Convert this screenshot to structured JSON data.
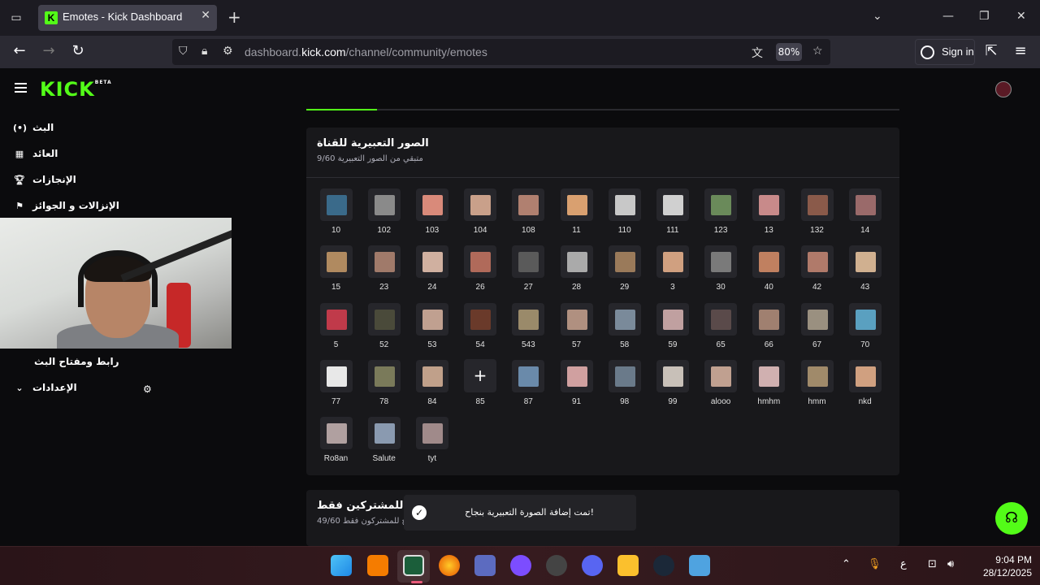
{
  "browser": {
    "tab_title": "Emotes - Kick Dashboard",
    "url_prefix": "dashboard.",
    "url_domain": "kick.com",
    "url_path": "/channel/community/emotes",
    "zoom": "80%",
    "sign_in": "Sign in"
  },
  "app": {
    "logo": "KICK",
    "logo_badge": "BETA"
  },
  "sidebar": {
    "items": [
      {
        "label": "البث",
        "icon": "broadcast-icon"
      },
      {
        "label": "العائد",
        "icon": "revenue-icon"
      },
      {
        "label": "الإنجازات",
        "icon": "trophy-icon"
      },
      {
        "label": "الإنزالات و الجوائز",
        "icon": "drops-icon"
      }
    ],
    "stream_key": "رابط ومفتاح البث",
    "settings": "الإعدادات"
  },
  "channel_emotes": {
    "title": "الصور التعبيرية للقناة",
    "subtitle": "متبقي من الصور التعبيرية 9/60",
    "emotes": [
      {
        "name": "10",
        "color": "#3a6a8a"
      },
      {
        "name": "102",
        "color": "#8a8a8a"
      },
      {
        "name": "103",
        "color": "#d98a7a"
      },
      {
        "name": "104",
        "color": "#c9a08a"
      },
      {
        "name": "108",
        "color": "#b08070"
      },
      {
        "name": "11",
        "color": "#d9a070"
      },
      {
        "name": "110",
        "color": "#c8c8c8"
      },
      {
        "name": "111",
        "color": "#d0d0d0"
      },
      {
        "name": "123",
        "color": "#6a8a5a"
      },
      {
        "name": "13",
        "color": "#c88a8a"
      },
      {
        "name": "132",
        "color": "#8a5a4a"
      },
      {
        "name": "14",
        "color": "#9a6a6a"
      },
      {
        "name": "15",
        "color": "#b08a60"
      },
      {
        "name": "23",
        "color": "#a07a6a"
      },
      {
        "name": "24",
        "color": "#d0b0a0"
      },
      {
        "name": "26",
        "color": "#b06a5a"
      },
      {
        "name": "27",
        "color": "#5a5a5a"
      },
      {
        "name": "28",
        "color": "#aaaaaa"
      },
      {
        "name": "29",
        "color": "#9a7a5a"
      },
      {
        "name": "3",
        "color": "#d0a080"
      },
      {
        "name": "30",
        "color": "#7a7a7a"
      },
      {
        "name": "40",
        "color": "#c08060"
      },
      {
        "name": "42",
        "color": "#b07a6a"
      },
      {
        "name": "43",
        "color": "#d0b090"
      },
      {
        "name": "5",
        "color": "#c03a4a"
      },
      {
        "name": "52",
        "color": "#4a4a3a"
      },
      {
        "name": "53",
        "color": "#c0a090"
      },
      {
        "name": "54",
        "color": "#6a3a2a"
      },
      {
        "name": "543",
        "color": "#9a8a6a"
      },
      {
        "name": "57",
        "color": "#b09080"
      },
      {
        "name": "58",
        "color": "#7a8a9a"
      },
      {
        "name": "59",
        "color": "#c0a0a0"
      },
      {
        "name": "65",
        "color": "#5a4a4a"
      },
      {
        "name": "66",
        "color": "#a08070"
      },
      {
        "name": "67",
        "color": "#9a9080"
      },
      {
        "name": "70",
        "color": "#5aa0c0"
      },
      {
        "name": "77",
        "color": "#e8e8e8"
      },
      {
        "name": "78",
        "color": "#7a7a5a"
      },
      {
        "name": "84",
        "color": "#c0a08a"
      },
      {
        "name": "85",
        "color": "#b09a70"
      },
      {
        "name": "87",
        "color": "#6a8aaa"
      },
      {
        "name": "91",
        "color": "#d0a0a0"
      },
      {
        "name": "98",
        "color": "#6a7a8a"
      },
      {
        "name": "99",
        "color": "#c8c0b8"
      },
      {
        "name": "alooo",
        "color": "#c0a090"
      },
      {
        "name": "hmhm",
        "color": "#d0b0b0"
      },
      {
        "name": "hmm",
        "color": "#a08a6a"
      },
      {
        "name": "nkd",
        "color": "#d0a080"
      },
      {
        "name": "Ro8an",
        "color": "#b0a0a0"
      },
      {
        "name": "Salute",
        "color": "#8a9ab0"
      },
      {
        "name": "tyt",
        "color": "#a08a8a"
      }
    ],
    "add_label": "+"
  },
  "subscriber_emotes": {
    "title": "مخصصة للمشتركين فقط",
    "subtitle": "متاح للمشتركون فقط 49/60"
  },
  "toast": {
    "message": "تمت إضافة الصورة التعبيرية بنجاح!"
  },
  "taskbar": {
    "time": "9:04 PM",
    "date": "28/12/2025",
    "lang": "ع"
  }
}
